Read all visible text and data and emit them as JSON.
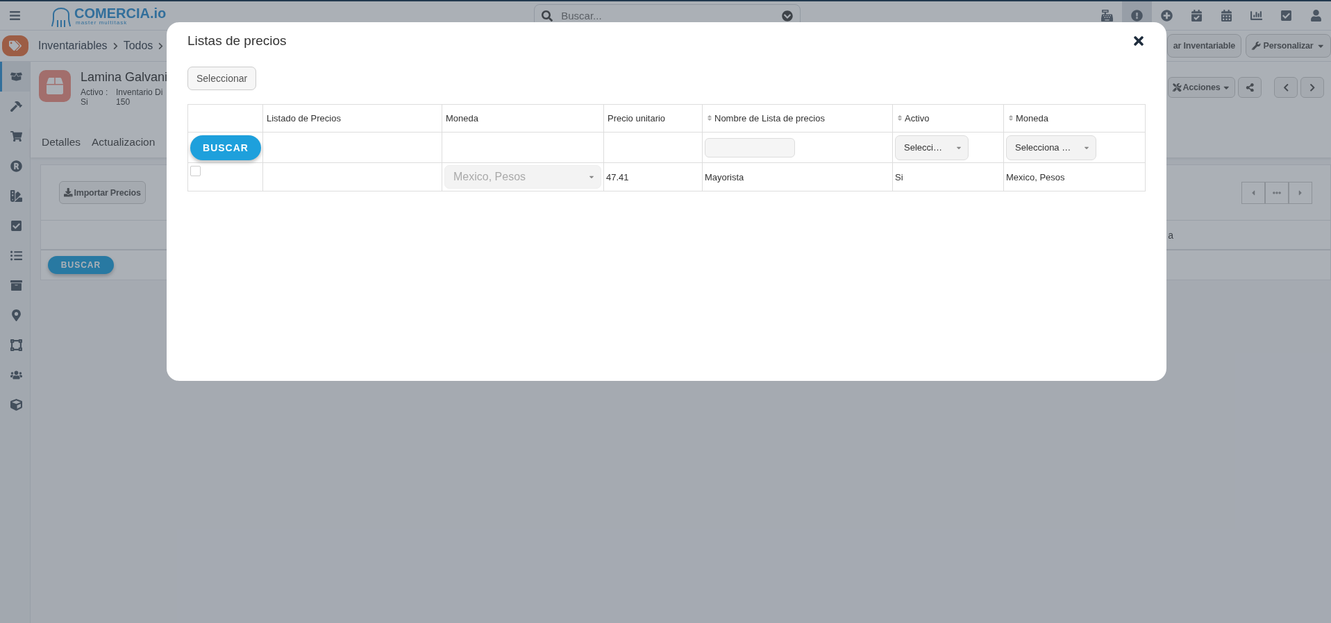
{
  "topbar": {
    "logo": {
      "name": "COMERCIA.io",
      "tagline": "master multitask"
    },
    "search": {
      "placeholder": "Buscar..."
    },
    "toolbar": [
      {
        "selected": false
      },
      {
        "selected": true
      },
      {
        "selected": false
      },
      {
        "selected": false
      },
      {
        "selected": false
      },
      {
        "selected": false
      },
      {
        "selected": false
      },
      {
        "selected": false
      }
    ]
  },
  "breadcrumb": [
    "Inventariables",
    "Todos"
  ],
  "header_buttons": [
    {
      "label": "ar Inventariable",
      "dropdown": false
    },
    {
      "label": "Personalizar",
      "dropdown": true
    }
  ],
  "sidebar": {
    "items": [
      {
        "selected": true
      },
      {
        "selected": false
      },
      {
        "selected": false
      },
      {
        "selected": false
      },
      {
        "selected": false
      },
      {
        "selected": false
      },
      {
        "selected": false
      },
      {
        "selected": false
      },
      {
        "selected": false
      },
      {
        "selected": false
      },
      {
        "selected": false
      },
      {
        "selected": false
      }
    ]
  },
  "product": {
    "title": "Lamina Galvani",
    "fields": [
      {
        "label": "Activo :",
        "value": "Si"
      },
      {
        "label": "Inventario Di",
        "value": "150"
      }
    ],
    "actions": "Acciones"
  },
  "tabs": [
    "Detalles",
    "Actualizacion"
  ],
  "panel": {
    "import_button": "Importar Precios",
    "column_3": "a",
    "search_button": "BUSCAR"
  },
  "modal": {
    "title": "Listas de precios",
    "select_button": "Seleccionar",
    "table": {
      "columns": [
        {
          "label": "Listado de Precios",
          "sortable": false
        },
        {
          "label": "Moneda",
          "sortable": false
        },
        {
          "label": "Precio unitario",
          "sortable": false
        },
        {
          "label": "Nombre de Lista de precios",
          "sortable": true
        },
        {
          "label": "Activo",
          "sortable": true
        },
        {
          "label": "Moneda",
          "sortable": true
        }
      ],
      "search_button": "BUSCAR",
      "filters": [
        {
          "kind": "none"
        },
        {
          "kind": "none"
        },
        {
          "kind": "none"
        },
        {
          "kind": "text"
        },
        {
          "kind": "select",
          "value": "Selecci…"
        },
        {
          "kind": "select",
          "value": "Selecciona …"
        }
      ],
      "rows": [
        {
          "checked": false,
          "moneda": {
            "value": "Mexico, Pesos",
            "disabled": true
          },
          "precio_unitario": "47.41",
          "nombre": "Mayorista",
          "activo": "Si",
          "moneda_text": "Mexico, Pesos"
        }
      ]
    }
  }
}
